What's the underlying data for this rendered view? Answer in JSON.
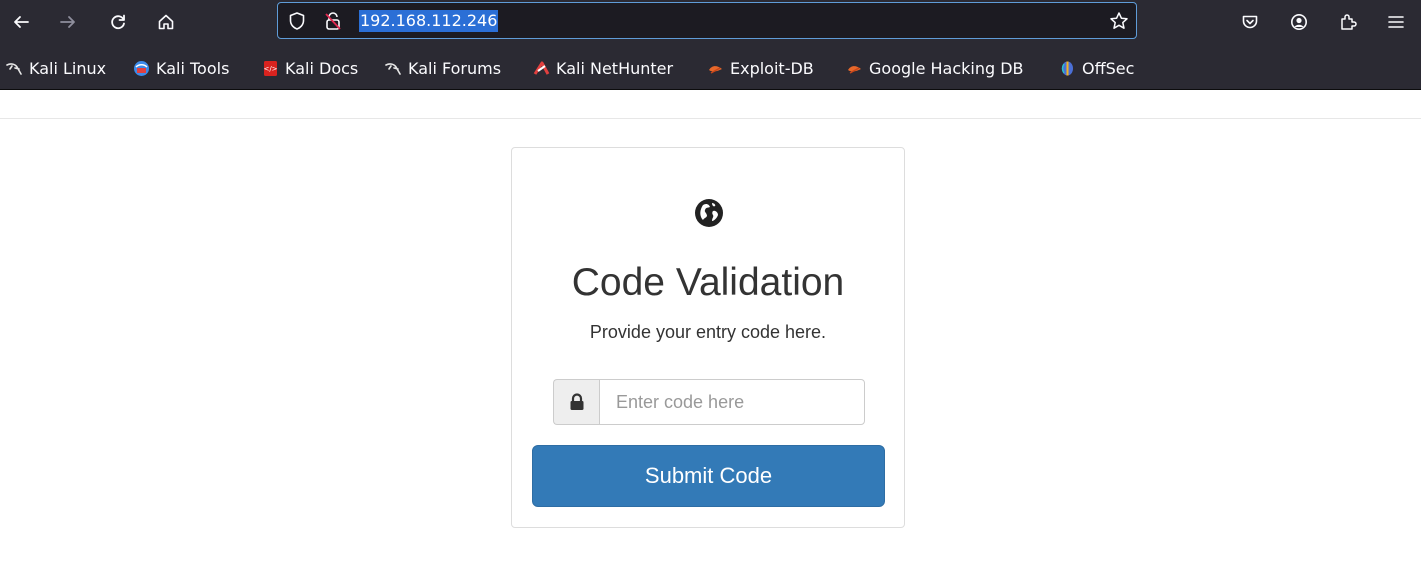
{
  "browser": {
    "url": "192.168.112.246",
    "icons": {
      "back": "back-arrow-icon",
      "forward": "forward-arrow-icon",
      "reload": "reload-icon",
      "home": "home-icon",
      "shield": "tracking-protection-shield-icon",
      "insecure": "insecure-connection-icon",
      "bookmark_star": "star-icon",
      "pocket": "pocket-icon",
      "account": "account-icon",
      "extensions": "extensions-icon",
      "menu": "hamburger-menu-icon"
    },
    "bookmarks": [
      {
        "label": "Kali Linux",
        "icon": "kali-dragon-icon"
      },
      {
        "label": "Kali Tools",
        "icon": "kali-tools-icon"
      },
      {
        "label": "Kali Docs",
        "icon": "kali-docs-icon"
      },
      {
        "label": "Kali Forums",
        "icon": "kali-dragon-icon"
      },
      {
        "label": "Kali NetHunter",
        "icon": "nethunter-icon"
      },
      {
        "label": "Exploit-DB",
        "icon": "exploit-db-icon"
      },
      {
        "label": "Google Hacking DB",
        "icon": "exploit-db-icon"
      },
      {
        "label": "OffSec",
        "icon": "offsec-icon"
      }
    ]
  },
  "page": {
    "icon": "globe-icon",
    "title": "Code Validation",
    "subtitle": "Provide your entry code here.",
    "input": {
      "icon": "lock-icon",
      "placeholder": "Enter code here",
      "value": ""
    },
    "submit_label": "Submit Code"
  },
  "colors": {
    "chrome_bg": "#2b2a33",
    "urlbar_bg": "#1c1b22",
    "url_selection": "#2b6fd6",
    "primary_button": "#337ab7"
  }
}
